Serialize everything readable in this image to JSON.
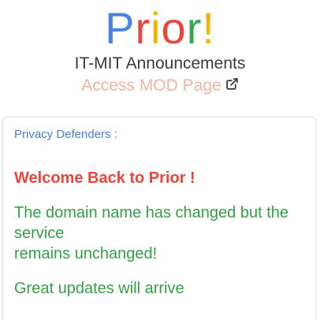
{
  "logo": {
    "letters": [
      {
        "char": "P",
        "color": "#4a83e6"
      },
      {
        "char": "r",
        "color": "#e8453c"
      },
      {
        "char": "i",
        "color": "#f4b400"
      },
      {
        "char": "o",
        "color": "#e8453c"
      },
      {
        "char": "r",
        "color": "#34a853"
      },
      {
        "char": "!",
        "color": "#f4b400"
      }
    ]
  },
  "header": {
    "subtitle": "IT-MIT Announcements",
    "mod_link_label": "Access MOD Page",
    "mod_link_icon": "external-link-icon"
  },
  "announcement": {
    "sender": "Privacy Defenders :",
    "welcome": "Welcome Back to Prior !",
    "message_line1": "The domain name has changed but the service",
    "message_line2": "remains unchanged!",
    "message2": "Great updates will arrive"
  },
  "colors": {
    "sender": "#4a7fd0",
    "welcome": "#e8453c",
    "message": "#34a046",
    "mod_link": "#f2b3a1"
  }
}
